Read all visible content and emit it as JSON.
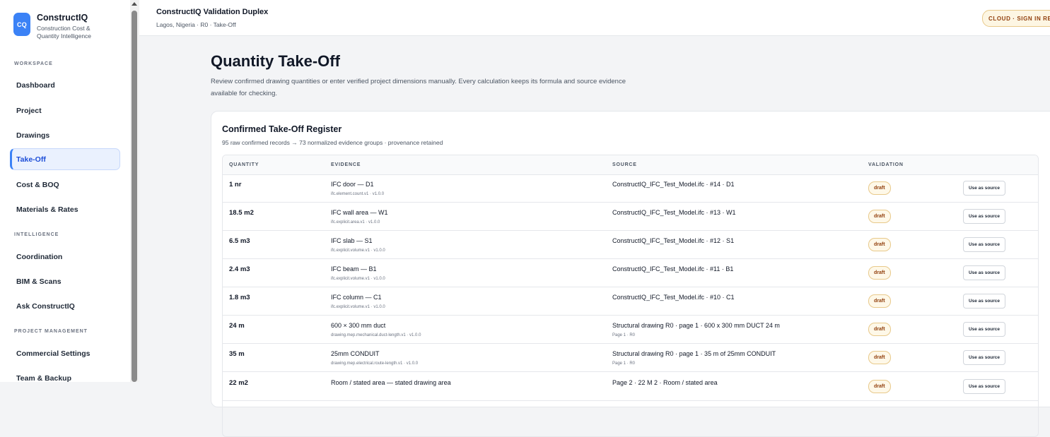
{
  "brand": {
    "logo": "CQ",
    "name": "ConstructIQ",
    "tagline": "Construction Cost & Quantity Intelligence"
  },
  "sidebar": {
    "sections": [
      {
        "label": "WORKSPACE",
        "items": [
          {
            "label": "Dashboard"
          },
          {
            "label": "Project"
          },
          {
            "label": "Drawings"
          },
          {
            "label": "Take-Off",
            "active": true
          },
          {
            "label": "Cost & BOQ"
          },
          {
            "label": "Materials & Rates"
          }
        ]
      },
      {
        "label": "INTELLIGENCE",
        "items": [
          {
            "label": "Coordination"
          },
          {
            "label": "BIM & Scans"
          },
          {
            "label": "Ask ConstructIQ"
          }
        ]
      },
      {
        "label": "PROJECT MANAGEMENT",
        "items": [
          {
            "label": "Commercial Settings"
          },
          {
            "label": "Team & Backup"
          }
        ]
      }
    ]
  },
  "header": {
    "project_title": "ConstructIQ Validation Duplex",
    "project_sub": "Lagos, Nigeria · R0 · Take-Off",
    "cloud_badge": "CLOUD · SIGN IN REQ"
  },
  "main": {
    "title": "Quantity Take-Off",
    "description": "Review confirmed drawing quantities or enter verified project dimensions manually. Every calculation keeps its formula and source evidence available for checking."
  },
  "register": {
    "title": "Confirmed Take-Off Register",
    "subtitle": "95 raw confirmed records → 73 normalized evidence groups · provenance retained",
    "columns": [
      "QUANTITY",
      "EVIDENCE",
      "SOURCE",
      "VALIDATION"
    ],
    "action_label": "Use as source",
    "rows": [
      {
        "quantity": "1 nr",
        "evidence": "IFC door — D1",
        "evidence_sub": "ifc.element.count.v1 · v1.0.0",
        "source": "ConstructIQ_IFC_Test_Model.ifc · #14 · D1",
        "source_sub": "",
        "status": "draft"
      },
      {
        "quantity": "18.5 m2",
        "evidence": "IFC wall area — W1",
        "evidence_sub": "ifc.explicit.area.v1 · v1.0.0",
        "source": "ConstructIQ_IFC_Test_Model.ifc · #13 · W1",
        "source_sub": "",
        "status": "draft"
      },
      {
        "quantity": "6.5 m3",
        "evidence": "IFC slab — S1",
        "evidence_sub": "ifc.explicit.volume.v1 · v1.0.0",
        "source": "ConstructIQ_IFC_Test_Model.ifc · #12 · S1",
        "source_sub": "",
        "status": "draft"
      },
      {
        "quantity": "2.4 m3",
        "evidence": "IFC beam — B1",
        "evidence_sub": "ifc.explicit.volume.v1 · v1.0.0",
        "source": "ConstructIQ_IFC_Test_Model.ifc · #11 · B1",
        "source_sub": "",
        "status": "draft"
      },
      {
        "quantity": "1.8 m3",
        "evidence": "IFC column — C1",
        "evidence_sub": "ifc.explicit.volume.v1 · v1.0.0",
        "source": "ConstructIQ_IFC_Test_Model.ifc · #10 · C1",
        "source_sub": "",
        "status": "draft"
      },
      {
        "quantity": "24 m",
        "evidence": "600 × 300 mm duct",
        "evidence_sub": "drawing.mep.mechanical.duct-length.v1 · v1.0.0",
        "source": "Structural drawing R0 · page 1 · 600 x 300 mm DUCT 24 m",
        "source_sub": "Page 1 · R0",
        "status": "draft"
      },
      {
        "quantity": "35 m",
        "evidence": "25mm CONDUIT",
        "evidence_sub": "drawing.mep.electrical.route-length.v1 · v1.0.0",
        "source": "Structural drawing R0 · page 1 · 35 m of 25mm CONDUIT",
        "source_sub": "Page 1 · R0",
        "status": "draft"
      },
      {
        "quantity": "22 m2",
        "evidence": "Room / stated area — stated drawing area",
        "evidence_sub": "",
        "source": "Page 2 · 22 M 2 · Room / stated area",
        "source_sub": "",
        "status": "draft"
      }
    ]
  },
  "colors": {
    "accent": "#3b82f6",
    "active_bg": "#eaf1fe",
    "draft_badge_bg": "#fef8e8",
    "draft_badge_text": "#92400e"
  }
}
